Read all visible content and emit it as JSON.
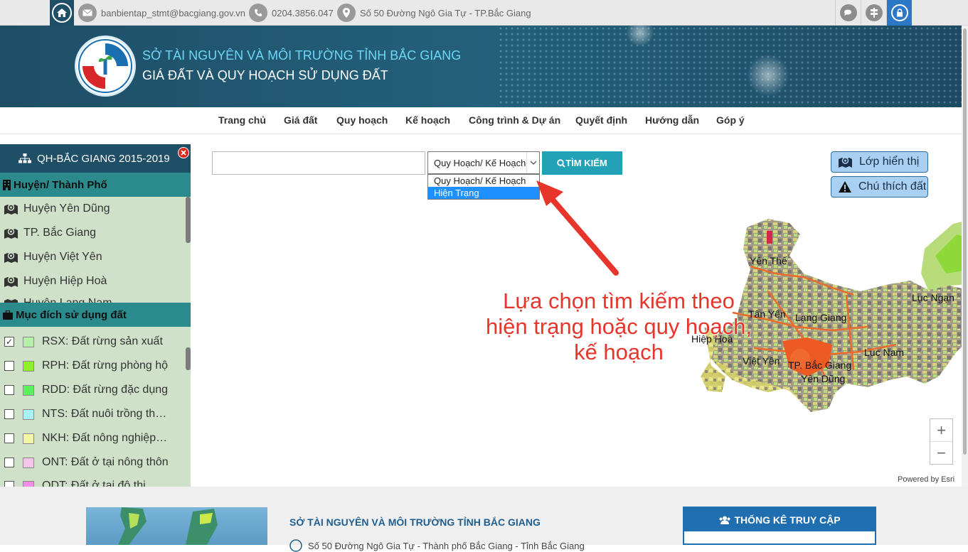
{
  "topbar": {
    "email": "banbientap_stmt@bacgiang.gov.vn",
    "phone": "0204.3856.047",
    "address": "Số 50 Đường Ngô Gia Tự - TP.Bắc Giang"
  },
  "header": {
    "title_line1": "SỞ TÀI NGUYÊN VÀ MÔI TRƯỜNG TỈNH BẮC GIANG",
    "title_line2": "GIÁ ĐẤT VÀ QUY HOẠCH SỬ DỤNG ĐẤT",
    "logo_text": "TÀI NGUYÊN VÀ MÔI TRƯỜNG"
  },
  "nav": [
    "Trang chủ",
    "Giá đất",
    "Quy hoạch",
    "Kế hoạch",
    "Công trình & Dự án",
    "Quyết định",
    "Hướng dẫn",
    "Góp ý"
  ],
  "sidebar": {
    "title": "QH-BẮC GIANG 2015-2019",
    "district_header": "Huyện/ Thành Phố",
    "districts": [
      "Huyện Yên Dũng",
      "TP. Bắc Giang",
      "Huyện Việt Yên",
      "Huyện Hiệp Hoà",
      "Huyện Lạng Nam"
    ],
    "landuse_header": "Mục đích sử dụng đất",
    "landuse": [
      {
        "label": "RSX: Đất rừng sản xuất",
        "color": "#b4f0a8",
        "checked": true
      },
      {
        "label": "RPH: Đất rừng phòng hộ",
        "color": "#8ef029",
        "checked": false
      },
      {
        "label": "RDD: Đất rừng đặc dụng",
        "color": "#5cf15c",
        "checked": false
      },
      {
        "label": "NTS: Đất nuôi trồng th…",
        "color": "#a9f2f4",
        "checked": false
      },
      {
        "label": "NKH: Đất nông nghiệp…",
        "color": "#f2f4a6",
        "checked": false
      },
      {
        "label": "ONT: Đất ở tại nông thôn",
        "color": "#f4c6ec",
        "checked": false
      },
      {
        "label": "ODT: Đất ở tại đô thị",
        "color": "#f58ce6",
        "checked": false
      }
    ]
  },
  "search": {
    "query": "",
    "select_value": "Quy Hoạch/ Kế Hoạch",
    "options": [
      "Quy Hoạch/ Kế Hoạch",
      "Hiện Trạng"
    ],
    "button_label": "TÌM KIẾM"
  },
  "map_buttons": {
    "layers": "Lớp hiển thị",
    "legend": "Chú thích đất"
  },
  "map": {
    "labels": [
      "Yên Thế",
      "Lục Ngạn",
      "Tân Yên",
      "Lạng Giang",
      "Việt Yên",
      "TP. Bắc Giang",
      "Lục Nam",
      "Yên Dũng",
      "Hiệp Hoà"
    ],
    "zoom_in": "+",
    "zoom_out": "−",
    "powered_by": "Powered by Esri"
  },
  "annotation": {
    "line1": "Lựa chọn tìm kiếm theo",
    "line2": "hiện trạng hoặc quy hoạch,",
    "line3": "kế hoạch"
  },
  "footer": {
    "org": "SỞ TÀI NGUYÊN VÀ MÔI TRƯỜNG TỈNH BẮC GIANG",
    "address": "Số 50 Đường Ngô Gia Tự - Thành phố Bắc Giang - Tỉnh Bắc Giang",
    "stats_title": "THỐNG KÊ TRUY CẬP"
  },
  "colors": {
    "header_bg": "#1f4f66",
    "accent_teal": "#22a1b7",
    "annotation_red": "#e8352b",
    "sidebar_bg": "#cfe1c9"
  }
}
